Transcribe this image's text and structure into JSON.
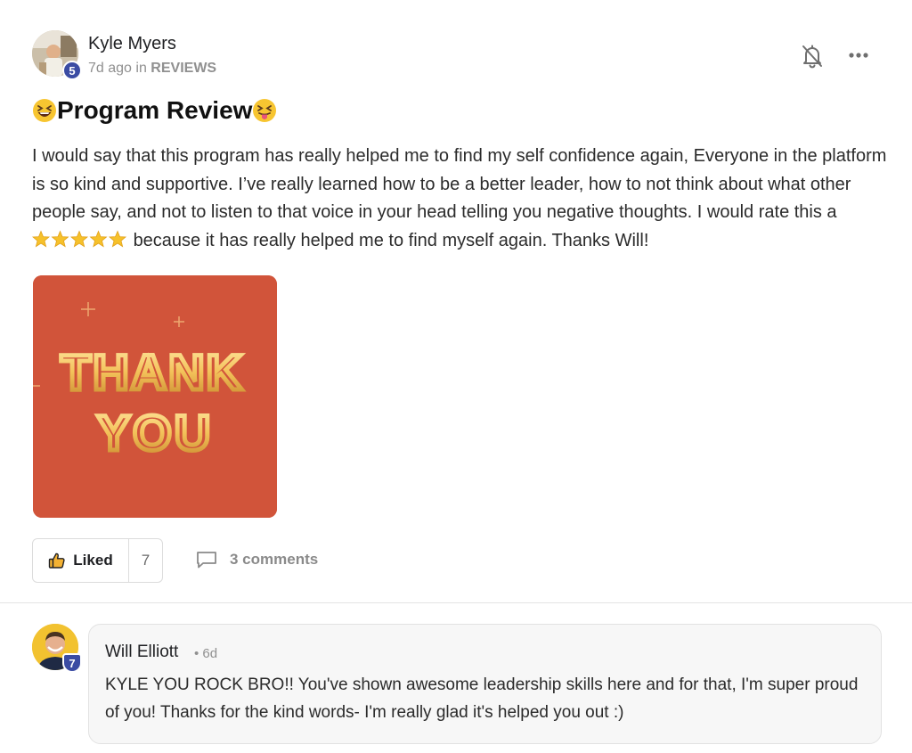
{
  "post": {
    "author": "Kyle Myers",
    "level": "5",
    "time": "7d ago",
    "in_word": "in",
    "category": "REVIEWS",
    "title": "Program Review",
    "body_before_stars": "I would say that this program has really helped me to find my self confidence again, Everyone in the platform is so kind and supportive. I’ve really learned how to be a better leader, how to not think about what other people say, and not to listen to that voice in your head telling you negative thoughts. I would rate this a",
    "rating_stars": 5,
    "body_after_stars": "because it has really helped me to find myself again. Thanks Will!",
    "image_text_line1": "THANK",
    "image_text_line2": "YOU",
    "like_label": "Liked",
    "like_count": "7",
    "comments_label": "3 comments"
  },
  "comment": {
    "author": "Will Elliott",
    "level": "7",
    "time": "• 6d",
    "text": "KYLE YOU ROCK BRO!! You've shown awesome leadership skills here and for that, I'm super proud of you! Thanks for the kind words- I'm really glad it's helped you out :)"
  },
  "icons": {
    "notifications_off": "bell-off-icon",
    "more": "more-horizontal-icon",
    "like": "thumbs-up-icon",
    "comment": "comment-icon"
  },
  "colors": {
    "level_badge": "#3b4ca3",
    "gif_background": "#d1543a",
    "gif_text_gold": "#f3c25a",
    "star_gold": "#f6c12b"
  }
}
